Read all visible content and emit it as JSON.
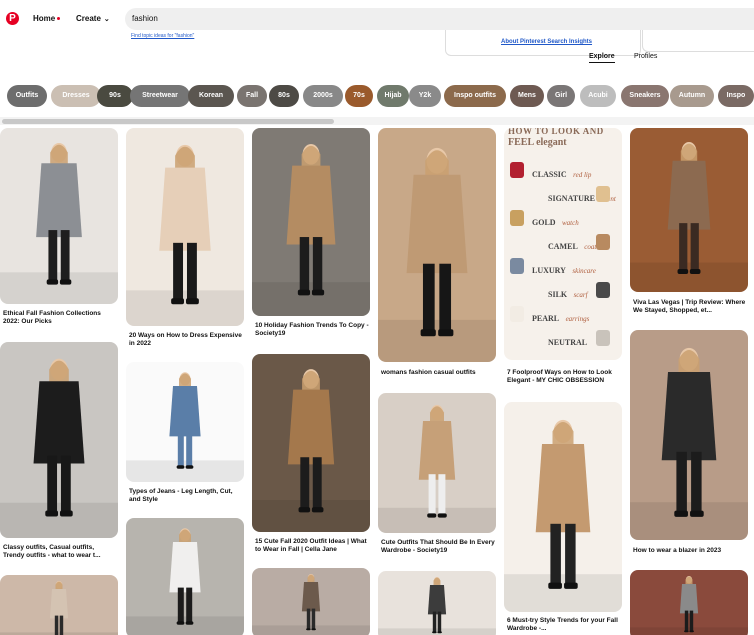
{
  "header": {
    "logo_letter": "P",
    "home_label": "Home",
    "create_label": "Create",
    "search_value": "fashion"
  },
  "search_dropdown": {
    "find_topic_link": "Find topic ideas for \"fashion\"",
    "about_link": "About Pinterest Search Insights",
    "tabs": [
      "Explore",
      "Profiles"
    ]
  },
  "chips": [
    {
      "label": "Outfits",
      "color": "#6d6d6d"
    },
    {
      "label": "Dresses",
      "color": "#cbbfb3"
    },
    {
      "label": "90s",
      "color": "#4a4a40"
    },
    {
      "label": "Streetwear",
      "color": "#757575"
    },
    {
      "label": "Korean",
      "color": "#5b5650"
    },
    {
      "label": "Fall",
      "color": "#7a7470"
    },
    {
      "label": "80s",
      "color": "#4d4a45"
    },
    {
      "label": "2000s",
      "color": "#888"
    },
    {
      "label": "70s",
      "color": "#9a5a2c"
    },
    {
      "label": "Hijab",
      "color": "#707a6c"
    },
    {
      "label": "Y2k",
      "color": "#8a8a8a"
    },
    {
      "label": "Inspo outfits",
      "color": "#8c6a4c"
    },
    {
      "label": "Mens",
      "color": "#6e5a52"
    },
    {
      "label": "Girl",
      "color": "#7a7676"
    },
    {
      "label": "Acubi",
      "color": "#bdbdbd"
    },
    {
      "label": "Sneakers",
      "color": "#8a7670"
    },
    {
      "label": "Autumn",
      "color": "#a89a8e"
    },
    {
      "label": "Inspo",
      "color": "#7a6a64"
    }
  ],
  "pins": [
    {
      "caption": "Ethical Fall Fashion Collections 2022: Our Picks",
      "bg": "#e8e4e0",
      "coat": "#8c8f94",
      "pants": "#1e1e1e"
    },
    {
      "caption": "Classy outfits, Casual outfits, Trendy outfits - what to wear t...",
      "bg": "#c9c6c2",
      "coat": "#1c1c1c",
      "pants": "#181818"
    },
    {
      "caption": "",
      "bg": "#cdb8a8",
      "coat": "#d4c3b2",
      "pants": "#2a2a2a"
    },
    {
      "caption": "20 Ways on How to Dress Expensive in 2022",
      "bg": "#efe8e0",
      "coat": "#e6cfb8",
      "pants": "#1a1a1a"
    },
    {
      "caption": "Types of Jeans - Leg Length, Cut, and Style",
      "bg": "#fafafa",
      "coat": "#5a7ea8",
      "pants": "#5a7ea8"
    },
    {
      "caption": "",
      "bg": "#b7b4ae",
      "coat": "#f0efee",
      "pants": "#1b1b1b"
    },
    {
      "caption": "10 Holiday Fashion Trends To Copy - Society19",
      "bg": "#7f7a74",
      "coat": "#b48c62",
      "pants": "#1c1c1c"
    },
    {
      "caption": "15 Cute Fall 2020 Outfit Ideas | What to Wear in Fall | Cella Jane",
      "bg": "#6a5848",
      "coat": "#a4784c",
      "pants": "#1c1c1c"
    },
    {
      "caption": "",
      "bg": "#b9aca4",
      "coat": "#6c5a4c",
      "pants": "#2a2a2a"
    },
    {
      "caption": "womans fashion casual outfits",
      "bg": "#c8a888",
      "coat": "#bf9a74",
      "pants": "#161616"
    },
    {
      "caption": "Cute Outfits That Should Be In Every Wardrobe - Society19",
      "bg": "#d8cfc6",
      "coat": "#c6a078",
      "pants": "#eeeeee"
    },
    {
      "caption": "",
      "bg": "#e8e2dc",
      "coat": "#3c3c3c",
      "pants": "#222"
    },
    {
      "caption": "7 Foolproof Ways on How to Look Elegant - MY CHIC OBSESSION",
      "bg": "#f5f0ea",
      "coat": "#c49a70",
      "pants": "#222"
    },
    {
      "caption": "6 Must-try Style Trends for your Fall Wardrobe -...",
      "bg": "#9a5c34",
      "coat": "#8c6a50",
      "pants": "#3a2a22"
    },
    {
      "caption": "Viva Las Vegas | Trip Review: Where We Stayed, Shopped, et...",
      "bg": "#b89c88",
      "coat": "#2a2a2a",
      "pants": "#1c1c1c"
    },
    {
      "caption": "How to wear a blazer in 2023",
      "bg": "#8a4a3c",
      "coat": "#8a8a8a",
      "pants": "#1c1c1c"
    },
    {
      "caption": "",
      "bg": "#a4603c",
      "coat": "#7a4a30",
      "pants": "#222"
    }
  ],
  "elegant_pin": {
    "headline_top": "HOW TO LOOK AND",
    "headline_bottom": "FEEL elegant",
    "items": [
      {
        "label": "CLASSIC",
        "sub": "red lip"
      },
      {
        "label": "SIGNATURE",
        "sub": "scent"
      },
      {
        "label": "GOLD",
        "sub": "watch"
      },
      {
        "label": "CAMEL",
        "sub": "coat"
      },
      {
        "label": "LUXURY",
        "sub": "skincare"
      },
      {
        "label": "SILK",
        "sub": "scarf"
      },
      {
        "label": "PEARL",
        "sub": "earrings"
      },
      {
        "label": "NEUTRAL",
        "sub": ""
      }
    ]
  }
}
